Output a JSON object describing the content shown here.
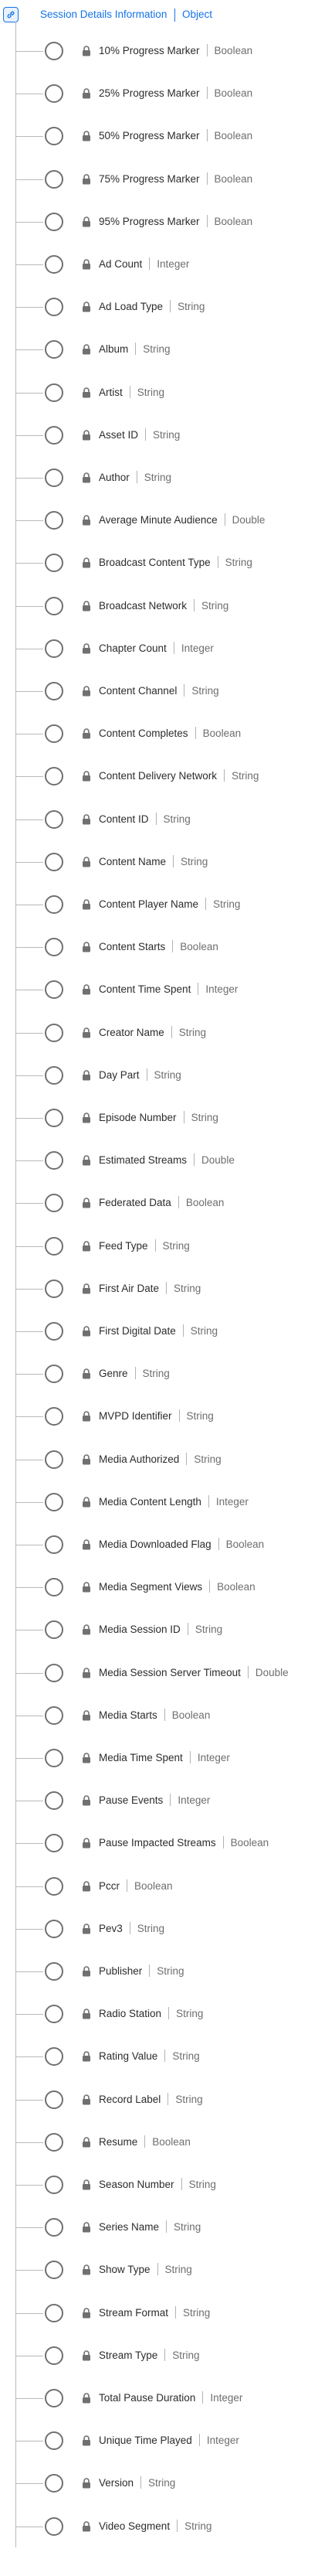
{
  "root": {
    "icon": "link-icon",
    "name": "Session Details Information",
    "type": "Object"
  },
  "fields": [
    {
      "name": "10% Progress Marker",
      "type": "Boolean"
    },
    {
      "name": "25% Progress Marker",
      "type": "Boolean"
    },
    {
      "name": "50% Progress Marker",
      "type": "Boolean"
    },
    {
      "name": "75% Progress Marker",
      "type": "Boolean"
    },
    {
      "name": "95% Progress Marker",
      "type": "Boolean"
    },
    {
      "name": "Ad Count",
      "type": "Integer"
    },
    {
      "name": "Ad Load Type",
      "type": "String"
    },
    {
      "name": "Album",
      "type": "String"
    },
    {
      "name": "Artist",
      "type": "String"
    },
    {
      "name": "Asset ID",
      "type": "String"
    },
    {
      "name": "Author",
      "type": "String"
    },
    {
      "name": "Average Minute Audience",
      "type": "Double"
    },
    {
      "name": "Broadcast Content Type",
      "type": "String"
    },
    {
      "name": "Broadcast Network",
      "type": "String"
    },
    {
      "name": "Chapter Count",
      "type": "Integer"
    },
    {
      "name": "Content Channel",
      "type": "String"
    },
    {
      "name": "Content Completes",
      "type": "Boolean"
    },
    {
      "name": "Content Delivery Network",
      "type": "String"
    },
    {
      "name": "Content ID",
      "type": "String"
    },
    {
      "name": "Content Name",
      "type": "String"
    },
    {
      "name": "Content Player Name",
      "type": "String"
    },
    {
      "name": "Content Starts",
      "type": "Boolean"
    },
    {
      "name": "Content Time Spent",
      "type": "Integer"
    },
    {
      "name": "Creator Name",
      "type": "String"
    },
    {
      "name": "Day Part",
      "type": "String"
    },
    {
      "name": "Episode Number",
      "type": "String"
    },
    {
      "name": "Estimated Streams",
      "type": "Double"
    },
    {
      "name": "Federated Data",
      "type": "Boolean"
    },
    {
      "name": "Feed Type",
      "type": "String"
    },
    {
      "name": "First Air Date",
      "type": "String"
    },
    {
      "name": "First Digital Date",
      "type": "String"
    },
    {
      "name": "Genre",
      "type": "String"
    },
    {
      "name": "MVPD Identifier",
      "type": "String"
    },
    {
      "name": "Media Authorized",
      "type": "String"
    },
    {
      "name": "Media Content Length",
      "type": "Integer"
    },
    {
      "name": "Media Downloaded Flag",
      "type": "Boolean"
    },
    {
      "name": "Media Segment Views",
      "type": "Boolean"
    },
    {
      "name": "Media Session ID",
      "type": "String"
    },
    {
      "name": "Media Session Server Timeout",
      "type": "Double"
    },
    {
      "name": "Media Starts",
      "type": "Boolean"
    },
    {
      "name": "Media Time Spent",
      "type": "Integer"
    },
    {
      "name": "Pause Events",
      "type": "Integer"
    },
    {
      "name": "Pause Impacted Streams",
      "type": "Boolean"
    },
    {
      "name": "Pccr",
      "type": "Boolean"
    },
    {
      "name": "Pev3",
      "type": "String"
    },
    {
      "name": "Publisher",
      "type": "String"
    },
    {
      "name": "Radio Station",
      "type": "String"
    },
    {
      "name": "Rating Value",
      "type": "String"
    },
    {
      "name": "Record Label",
      "type": "String"
    },
    {
      "name": "Resume",
      "type": "Boolean"
    },
    {
      "name": "Season Number",
      "type": "String"
    },
    {
      "name": "Series Name",
      "type": "String"
    },
    {
      "name": "Show Type",
      "type": "String"
    },
    {
      "name": "Stream Format",
      "type": "String"
    },
    {
      "name": "Stream Type",
      "type": "String"
    },
    {
      "name": "Total Pause Duration",
      "type": "Integer"
    },
    {
      "name": "Unique Time Played",
      "type": "Integer"
    },
    {
      "name": "Version",
      "type": "String"
    },
    {
      "name": "Video Segment",
      "type": "String"
    }
  ]
}
